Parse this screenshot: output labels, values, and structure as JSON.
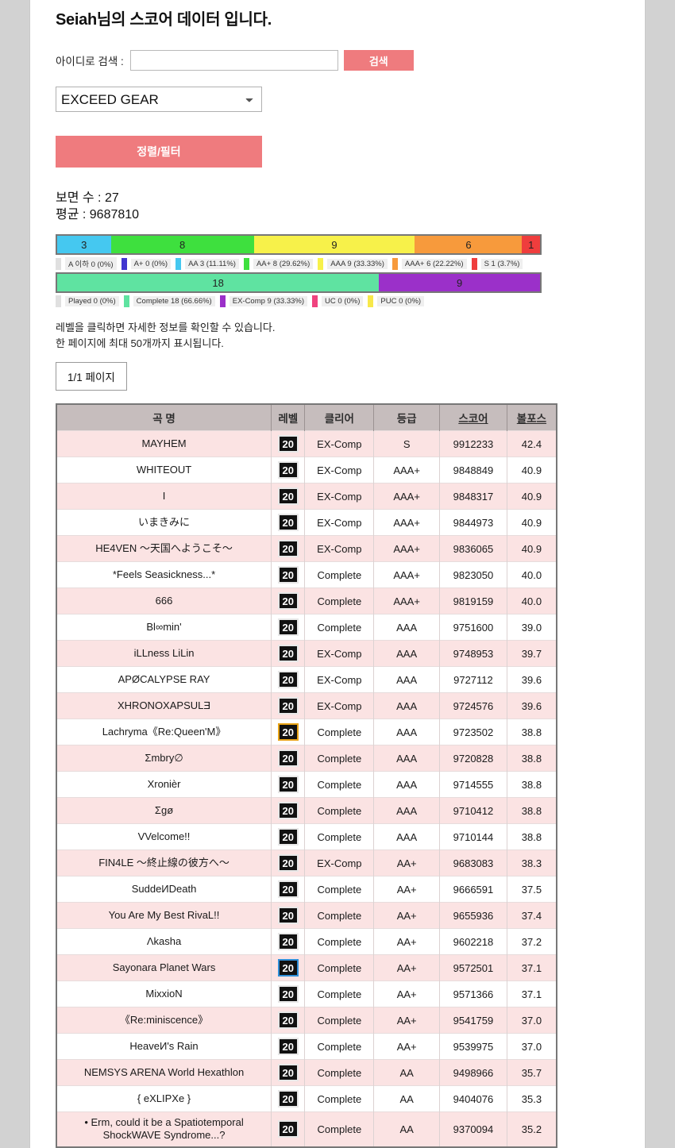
{
  "header": {
    "title": "Seiah님의 스코어 데이터 입니다."
  },
  "search": {
    "label": "아이디로 검색 :",
    "value": "",
    "placeholder": "",
    "button_label": "검색"
  },
  "version_select": {
    "selected": "EXCEED GEAR",
    "options": [
      "EXCEED GEAR"
    ]
  },
  "filter_button": {
    "label": "정렬/필터"
  },
  "stats": {
    "chart_count_label": "보면 수 : 27",
    "average_label": "평균 : 9687810"
  },
  "notes": {
    "line1": "레벨을 클릭하면 자세한 정보를 확인할 수 있습니다.",
    "line2": "한 페이지에 최대 50개까지 표시됩니다."
  },
  "pagination": {
    "label": "1/1 페이지"
  },
  "chart_data": [
    {
      "type": "bar",
      "title": "등급 분포",
      "orientation": "horizontal-stacked",
      "categories": [
        "A 이하",
        "A+",
        "AA",
        "AA+",
        "AAA",
        "AAA+",
        "S"
      ],
      "values": [
        0,
        0,
        3,
        8,
        9,
        6,
        1
      ],
      "percents": [
        "0%",
        "0%",
        "11.11%",
        "29.62%",
        "33.33%",
        "22.22%",
        "3.7%"
      ],
      "colors": [
        "#e0e0e0",
        "#4136d0",
        "#45c8f0",
        "#3ee03e",
        "#f7f14a",
        "#f79a3c",
        "#ef3d3d"
      ],
      "legend_labels": [
        "A 이하  0 (0%)",
        "A+  0 (0%)",
        "AA  3 (11.11%)",
        "AA+  8 (29.62%)",
        "AAA  9 (33.33%)",
        "AAA+  6 (22.22%)",
        "S  1 (3.7%)"
      ],
      "bar_segments": [
        {
          "label": "3",
          "value": 3,
          "color": "#45c8f0"
        },
        {
          "label": "8",
          "value": 8,
          "color": "#3ee03e"
        },
        {
          "label": "9",
          "value": 9,
          "color": "#f7f14a"
        },
        {
          "label": "6",
          "value": 6,
          "color": "#f79a3c"
        },
        {
          "label": "1",
          "value": 1,
          "color": "#ef3d3d"
        }
      ],
      "total": 27
    },
    {
      "type": "bar",
      "title": "클리어 분포",
      "orientation": "horizontal-stacked",
      "categories": [
        "Played",
        "Complete",
        "EX-Comp",
        "UC",
        "PUC"
      ],
      "values": [
        0,
        18,
        9,
        0,
        0
      ],
      "percents": [
        "0%",
        "66.66%",
        "33.33%",
        "0%",
        "0%"
      ],
      "colors": [
        "#e0e0e0",
        "#5fe3a1",
        "#9b30c9",
        "#f0437f",
        "#f7e84a"
      ],
      "legend_labels": [
        "Played  0 (0%)",
        "Complete  18 (66.66%)",
        "EX-Comp  9 (33.33%)",
        "UC  0 (0%)",
        "PUC  0 (0%)"
      ],
      "bar_segments": [
        {
          "label": "18",
          "value": 18,
          "color": "#5fe3a1"
        },
        {
          "label": "9",
          "value": 9,
          "color": "#9b30c9"
        }
      ],
      "total": 27
    }
  ],
  "table": {
    "columns": [
      {
        "label": "곡 명",
        "sortable": false
      },
      {
        "label": "레벨",
        "sortable": false
      },
      {
        "label": "클리어",
        "sortable": false
      },
      {
        "label": "등급",
        "sortable": false
      },
      {
        "label": "스코어",
        "sortable": true
      },
      {
        "label": "볼포스",
        "sortable": true
      }
    ],
    "rows": [
      {
        "song": "MAYHEM",
        "level": "20",
        "badge": "black",
        "clear": "EX-Comp",
        "grade": "S",
        "score": "9912233",
        "vf": "42.4"
      },
      {
        "song": "WHITEOUT",
        "level": "20",
        "badge": "black",
        "clear": "EX-Comp",
        "grade": "AAA+",
        "score": "9848849",
        "vf": "40.9"
      },
      {
        "song": "I",
        "level": "20",
        "badge": "black",
        "clear": "EX-Comp",
        "grade": "AAA+",
        "score": "9848317",
        "vf": "40.9"
      },
      {
        "song": "いまきみに",
        "level": "20",
        "badge": "black",
        "clear": "EX-Comp",
        "grade": "AAA+",
        "score": "9844973",
        "vf": "40.9"
      },
      {
        "song": "HE4VEN ～天国へようこそ～",
        "level": "20",
        "badge": "black",
        "clear": "EX-Comp",
        "grade": "AAA+",
        "score": "9836065",
        "vf": "40.9"
      },
      {
        "song": "*Feels Seasickness...*",
        "level": "20",
        "badge": "black",
        "clear": "Complete",
        "grade": "AAA+",
        "score": "9823050",
        "vf": "40.0"
      },
      {
        "song": "666",
        "level": "20",
        "badge": "black",
        "clear": "Complete",
        "grade": "AAA+",
        "score": "9819159",
        "vf": "40.0"
      },
      {
        "song": "Bl∞min'",
        "level": "20",
        "badge": "black",
        "clear": "Complete",
        "grade": "AAA",
        "score": "9751600",
        "vf": "39.0"
      },
      {
        "song": "iLLness LiLin",
        "level": "20",
        "badge": "black",
        "clear": "EX-Comp",
        "grade": "AAA",
        "score": "9748953",
        "vf": "39.7"
      },
      {
        "song": "APØCALYPSE RAY",
        "level": "20",
        "badge": "black",
        "clear": "EX-Comp",
        "grade": "AAA",
        "score": "9727112",
        "vf": "39.6"
      },
      {
        "song": "XHRONOXAPSULƎ",
        "level": "20",
        "badge": "black",
        "clear": "EX-Comp",
        "grade": "AAA",
        "score": "9724576",
        "vf": "39.6"
      },
      {
        "song": "Lachryma《Re:Queen'M》",
        "level": "20",
        "badge": "gold",
        "clear": "Complete",
        "grade": "AAA",
        "score": "9723502",
        "vf": "38.8"
      },
      {
        "song": "Σmbry∅",
        "level": "20",
        "badge": "black",
        "clear": "Complete",
        "grade": "AAA",
        "score": "9720828",
        "vf": "38.8"
      },
      {
        "song": "Xronièr",
        "level": "20",
        "badge": "black",
        "clear": "Complete",
        "grade": "AAA",
        "score": "9714555",
        "vf": "38.8"
      },
      {
        "song": "Σgø",
        "level": "20",
        "badge": "black",
        "clear": "Complete",
        "grade": "AAA",
        "score": "9710412",
        "vf": "38.8"
      },
      {
        "song": "VVelcome!!",
        "level": "20",
        "badge": "black",
        "clear": "Complete",
        "grade": "AAA",
        "score": "9710144",
        "vf": "38.8"
      },
      {
        "song": "FIN4LE ～終止線の彼方へ～",
        "level": "20",
        "badge": "black",
        "clear": "EX-Comp",
        "grade": "AA+",
        "score": "9683083",
        "vf": "38.3"
      },
      {
        "song": "SuddeИDeath",
        "level": "20",
        "badge": "black",
        "clear": "Complete",
        "grade": "AA+",
        "score": "9666591",
        "vf": "37.5"
      },
      {
        "song": "You Are My Best RivaL!!",
        "level": "20",
        "badge": "black",
        "clear": "Complete",
        "grade": "AA+",
        "score": "9655936",
        "vf": "37.4"
      },
      {
        "song": "Λkasha",
        "level": "20",
        "badge": "black",
        "clear": "Complete",
        "grade": "AA+",
        "score": "9602218",
        "vf": "37.2"
      },
      {
        "song": "Sayonara Planet Wars",
        "level": "20",
        "badge": "blue",
        "clear": "Complete",
        "grade": "AA+",
        "score": "9572501",
        "vf": "37.1"
      },
      {
        "song": "MixxioN",
        "level": "20",
        "badge": "black",
        "clear": "Complete",
        "grade": "AA+",
        "score": "9571366",
        "vf": "37.1"
      },
      {
        "song": "《Re:miniscence》",
        "level": "20",
        "badge": "black",
        "clear": "Complete",
        "grade": "AA+",
        "score": "9541759",
        "vf": "37.0"
      },
      {
        "song": "HeaveИ's Rain",
        "level": "20",
        "badge": "black",
        "clear": "Complete",
        "grade": "AA+",
        "score": "9539975",
        "vf": "37.0"
      },
      {
        "song": "NEMSYS ARENA World Hexathlon",
        "level": "20",
        "badge": "black",
        "clear": "Complete",
        "grade": "AA",
        "score": "9498966",
        "vf": "35.7"
      },
      {
        "song": "{ eXLIPXe }",
        "level": "20",
        "badge": "black",
        "clear": "Complete",
        "grade": "AA",
        "score": "9404076",
        "vf": "35.3"
      },
      {
        "song": "• Erm, could it be a Spatiotemporal ShockWAVE Syndrome...?",
        "level": "20",
        "badge": "black",
        "clear": "Complete",
        "grade": "AA",
        "score": "9370094",
        "vf": "35.2"
      }
    ]
  }
}
